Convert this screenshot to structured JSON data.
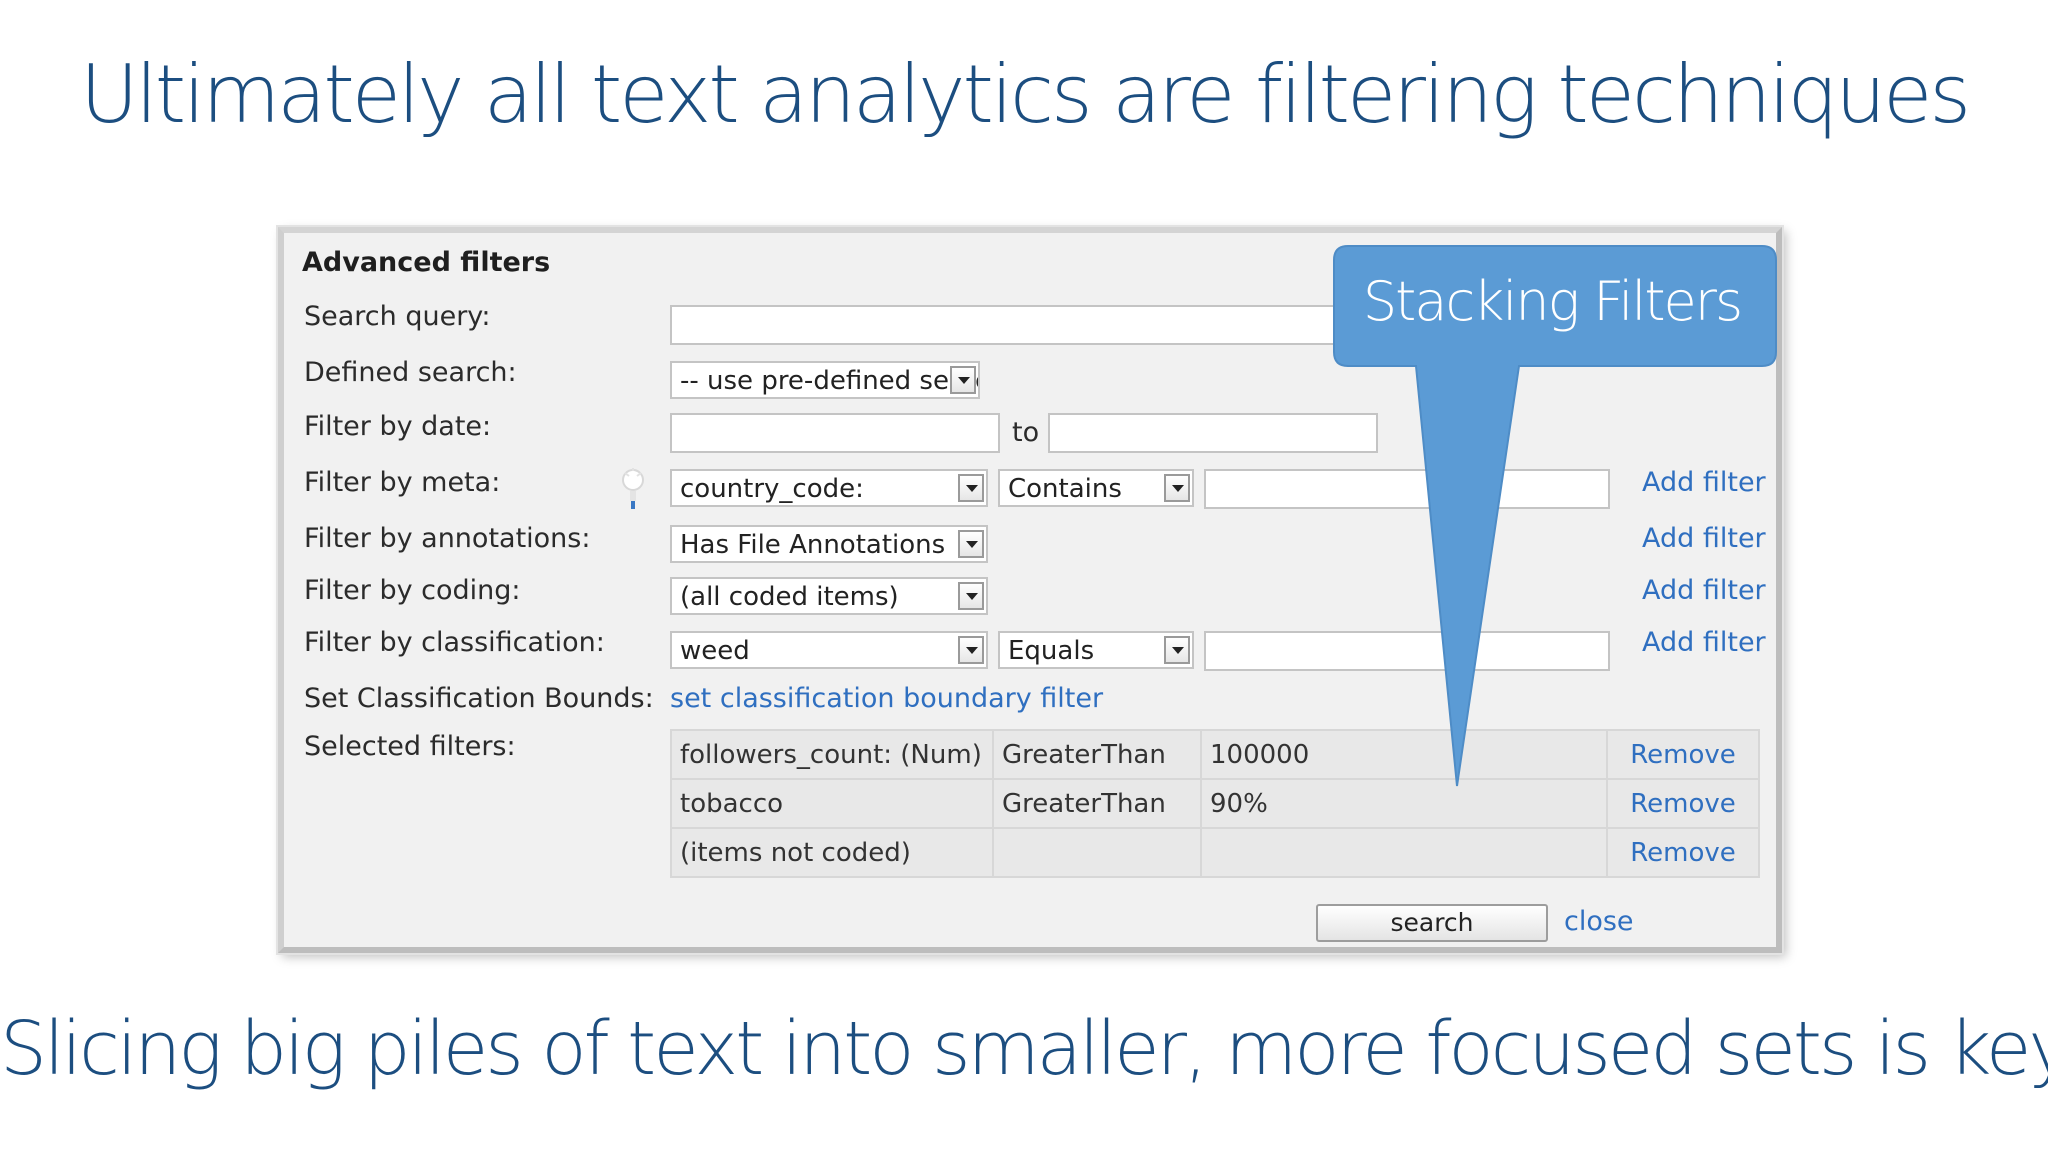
{
  "slide": {
    "title": "Ultimately all text analytics are filtering techniques",
    "subtitle": "Slicing big piles of text into smaller, more focused sets is key"
  },
  "callout": {
    "label": "Stacking Filters",
    "color": "#5b9bd5"
  },
  "panel": {
    "title": "Advanced filters",
    "labels": {
      "search_query": "Search query:",
      "defined_search": "Defined search:",
      "filter_by_date": "Filter by date:",
      "filter_by_meta": "Filter by meta:",
      "filter_by_annotations": "Filter by annotations:",
      "filter_by_coding": "Filter by coding:",
      "filter_by_classification": "Filter by classification:",
      "set_classification_bounds": "Set Classification Bounds:",
      "selected_filters": "Selected filters:"
    },
    "search_query": {
      "value": ""
    },
    "defined_search": {
      "selected": "-- use pre-defined search -"
    },
    "date": {
      "from": "",
      "to_label": "to",
      "to": ""
    },
    "meta": {
      "field": "country_code:",
      "operator": "Contains",
      "value": ""
    },
    "annotations": {
      "selected": "Has File Annotations"
    },
    "coding": {
      "selected": "(all coded items)"
    },
    "classification": {
      "field": "weed",
      "operator": "Equals",
      "value": ""
    },
    "add_filter_label": "Add filter",
    "classification_bounds_link": "set classification boundary filter",
    "selected_filters": [
      {
        "field": "followers_count: (Num)",
        "operator": "GreaterThan",
        "value": "100000",
        "remove": "Remove"
      },
      {
        "field": "tobacco",
        "operator": "GreaterThan",
        "value": "90%",
        "remove": "Remove"
      },
      {
        "field": "(items not coded)",
        "operator": "",
        "value": "",
        "remove": "Remove"
      }
    ],
    "search_button": "search",
    "close_link": "close"
  },
  "colors": {
    "title_text": "#1c4e80",
    "link": "#2f6fc0",
    "callout": "#5b9bd5"
  }
}
